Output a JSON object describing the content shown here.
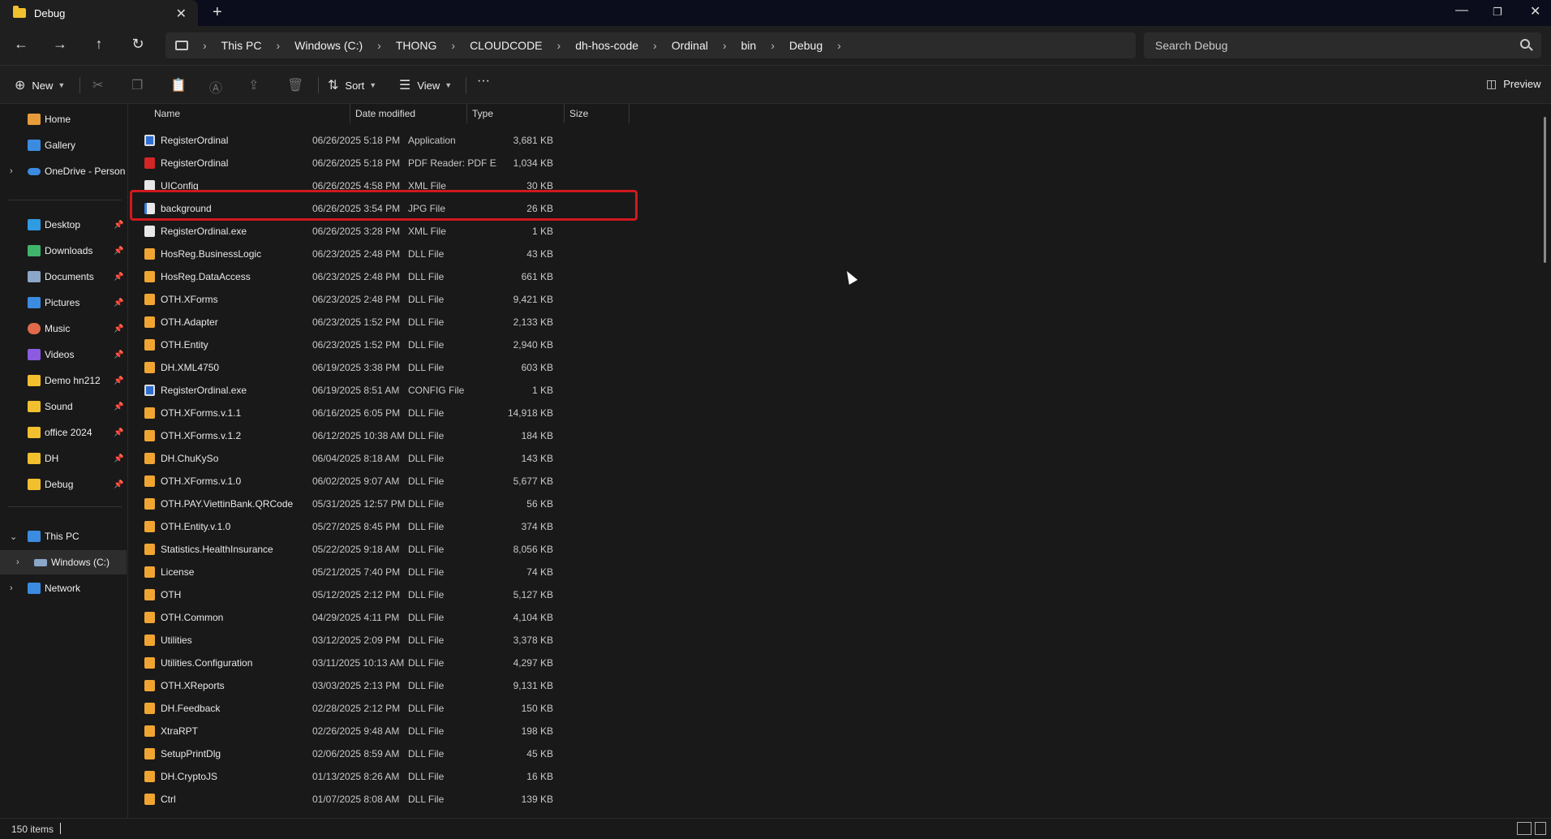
{
  "tab": {
    "title": "Debug",
    "close": "✕",
    "new_tab": "+"
  },
  "window_controls": {
    "minimize": "—",
    "maximize": "❐",
    "close": "✕"
  },
  "nav": {
    "back": "←",
    "forward": "→",
    "up": "↑",
    "refresh": "↻",
    "breadcrumbs": [
      "This PC",
      "Windows (C:)",
      "THONG",
      "CLOUDCODE",
      "dh-hos-code",
      "Ordinal",
      "bin",
      "Debug"
    ],
    "separator": "›",
    "search_placeholder": "Search Debug"
  },
  "command_bar": {
    "new_label": "New",
    "sort_label": "Sort",
    "view_label": "View",
    "more_label": "···",
    "preview_label": "Preview"
  },
  "sidebar": {
    "quick": [
      {
        "label": "Home",
        "color": "#e89b3b"
      },
      {
        "label": "Gallery",
        "color": "#3b8be0"
      },
      {
        "label": "OneDrive - Persona",
        "color": "#3b8be0"
      }
    ],
    "pinned": [
      {
        "label": "Desktop",
        "color": "#2f9be0"
      },
      {
        "label": "Downloads",
        "color": "#3fb56b"
      },
      {
        "label": "Documents",
        "color": "#8aa6c8"
      },
      {
        "label": "Pictures",
        "color": "#3b8be0"
      },
      {
        "label": "Music",
        "color": "#e06a4b"
      },
      {
        "label": "Videos",
        "color": "#8b5be0"
      },
      {
        "label": "Demo hn212",
        "color": "#f2c02f"
      },
      {
        "label": "Sound",
        "color": "#f2c02f"
      },
      {
        "label": "office 2024",
        "color": "#f2c02f"
      },
      {
        "label": "DH",
        "color": "#f2c02f"
      },
      {
        "label": "Debug",
        "color": "#f2c02f"
      }
    ],
    "tree": [
      {
        "label": "This PC",
        "color": "#3b8be0"
      },
      {
        "label": "Windows (C:)",
        "color": "#8aa6c8"
      },
      {
        "label": "Network",
        "color": "#3b8be0"
      }
    ]
  },
  "columns": {
    "name": "Name",
    "date": "Date modified",
    "type": "Type",
    "size": "Size"
  },
  "files": [
    {
      "name": "RegisterOrdinal",
      "date": "06/26/2025 5:18 PM",
      "type": "Application",
      "size": "3,681 KB",
      "icon": "app"
    },
    {
      "name": "RegisterOrdinal",
      "date": "06/26/2025 5:18 PM",
      "type": "PDF Reader: PDF E...",
      "size": "1,034 KB",
      "icon": "pdf"
    },
    {
      "name": "UIConfig",
      "date": "06/26/2025 4:58 PM",
      "type": "XML File",
      "size": "30 KB",
      "icon": "xml"
    },
    {
      "name": "background",
      "date": "06/26/2025 3:54 PM",
      "type": "JPG File",
      "size": "26 KB",
      "icon": "jpg"
    },
    {
      "name": "RegisterOrdinal.exe",
      "date": "06/26/2025 3:28 PM",
      "type": "XML File",
      "size": "1 KB",
      "icon": "xml"
    },
    {
      "name": "HosReg.BusinessLogic",
      "date": "06/23/2025 2:48 PM",
      "type": "DLL File",
      "size": "43 KB",
      "icon": "dll"
    },
    {
      "name": "HosReg.DataAccess",
      "date": "06/23/2025 2:48 PM",
      "type": "DLL File",
      "size": "661 KB",
      "icon": "dll"
    },
    {
      "name": "OTH.XForms",
      "date": "06/23/2025 2:48 PM",
      "type": "DLL File",
      "size": "9,421 KB",
      "icon": "dll"
    },
    {
      "name": "OTH.Adapter",
      "date": "06/23/2025 1:52 PM",
      "type": "DLL File",
      "size": "2,133 KB",
      "icon": "dll"
    },
    {
      "name": "OTH.Entity",
      "date": "06/23/2025 1:52 PM",
      "type": "DLL File",
      "size": "2,940 KB",
      "icon": "dll"
    },
    {
      "name": "DH.XML4750",
      "date": "06/19/2025 3:38 PM",
      "type": "DLL File",
      "size": "603 KB",
      "icon": "dll"
    },
    {
      "name": "RegisterOrdinal.exe",
      "date": "06/19/2025 8:51 AM",
      "type": "CONFIG File",
      "size": "1 KB",
      "icon": "cfg"
    },
    {
      "name": "OTH.XForms.v.1.1",
      "date": "06/16/2025 6:05 PM",
      "type": "DLL File",
      "size": "14,918 KB",
      "icon": "dll"
    },
    {
      "name": "OTH.XForms.v.1.2",
      "date": "06/12/2025 10:38 AM",
      "type": "DLL File",
      "size": "184 KB",
      "icon": "dll"
    },
    {
      "name": "DH.ChuKySo",
      "date": "06/04/2025 8:18 AM",
      "type": "DLL File",
      "size": "143 KB",
      "icon": "dll"
    },
    {
      "name": "OTH.XForms.v.1.0",
      "date": "06/02/2025 9:07 AM",
      "type": "DLL File",
      "size": "5,677 KB",
      "icon": "dll"
    },
    {
      "name": "OTH.PAY.ViettinBank.QRCode",
      "date": "05/31/2025 12:57 PM",
      "type": "DLL File",
      "size": "56 KB",
      "icon": "dll"
    },
    {
      "name": "OTH.Entity.v.1.0",
      "date": "05/27/2025 8:45 PM",
      "type": "DLL File",
      "size": "374 KB",
      "icon": "dll"
    },
    {
      "name": "Statistics.HealthInsurance",
      "date": "05/22/2025 9:18 AM",
      "type": "DLL File",
      "size": "8,056 KB",
      "icon": "dll"
    },
    {
      "name": "License",
      "date": "05/21/2025 7:40 PM",
      "type": "DLL File",
      "size": "74 KB",
      "icon": "dll"
    },
    {
      "name": "OTH",
      "date": "05/12/2025 2:12 PM",
      "type": "DLL File",
      "size": "5,127 KB",
      "icon": "dll"
    },
    {
      "name": "OTH.Common",
      "date": "04/29/2025 4:11 PM",
      "type": "DLL File",
      "size": "4,104 KB",
      "icon": "dll"
    },
    {
      "name": "Utilities",
      "date": "03/12/2025 2:09 PM",
      "type": "DLL File",
      "size": "3,378 KB",
      "icon": "dll"
    },
    {
      "name": "Utilities.Configuration",
      "date": "03/11/2025 10:13 AM",
      "type": "DLL File",
      "size": "4,297 KB",
      "icon": "dll"
    },
    {
      "name": "OTH.XReports",
      "date": "03/03/2025 2:13 PM",
      "type": "DLL File",
      "size": "9,131 KB",
      "icon": "dll"
    },
    {
      "name": "DH.Feedback",
      "date": "02/28/2025 2:12 PM",
      "type": "DLL File",
      "size": "150 KB",
      "icon": "dll"
    },
    {
      "name": "XtraRPT",
      "date": "02/26/2025 9:48 AM",
      "type": "DLL File",
      "size": "198 KB",
      "icon": "dll"
    },
    {
      "name": "SetupPrintDlg",
      "date": "02/06/2025 8:59 AM",
      "type": "DLL File",
      "size": "45 KB",
      "icon": "dll"
    },
    {
      "name": "DH.CryptoJS",
      "date": "01/13/2025 8:26 AM",
      "type": "DLL File",
      "size": "16 KB",
      "icon": "dll"
    },
    {
      "name": "Ctrl",
      "date": "01/07/2025 8:08 AM",
      "type": "DLL File",
      "size": "139 KB",
      "icon": "dll"
    }
  ],
  "highlighted_file": "background",
  "status": {
    "item_count": "150 items"
  }
}
